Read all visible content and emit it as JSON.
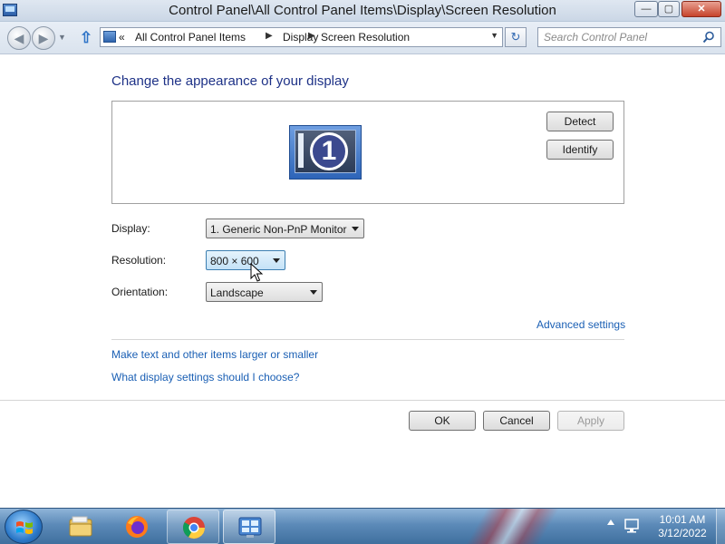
{
  "window": {
    "title": "Control Panel\\All Control Panel Items\\Display\\Screen Resolution",
    "min_label": "—",
    "max_label": "▢",
    "close_label": "✕"
  },
  "address": {
    "recent_glyph": "▼",
    "lead_chevron": "«",
    "segments": [
      "All Control Panel Items",
      "Display",
      "Screen Resolution"
    ],
    "separator": "▶",
    "dropdown_glyph": "▼",
    "refresh_glyph": "↻"
  },
  "search": {
    "placeholder": "Search Control Panel"
  },
  "page": {
    "heading": "Change the appearance of your display",
    "monitor_number": "1",
    "detect_label": "Detect",
    "identify_label": "Identify",
    "display_label": "Display:",
    "display_value": "1. Generic Non-PnP Monitor",
    "resolution_label": "Resolution:",
    "resolution_value": "800 × 600",
    "orientation_label": "Orientation:",
    "orientation_value": "Landscape",
    "advanced_link": "Advanced settings",
    "larger_link": "Make text and other items larger or smaller",
    "which_link": "What display settings should I choose?",
    "ok_label": "OK",
    "cancel_label": "Cancel",
    "apply_label": "Apply"
  },
  "taskbar": {
    "items": [
      "Windows Explorer",
      "Firefox",
      "Chrome",
      "Control Panel"
    ],
    "time": "10:01 AM",
    "date": "3/12/2022"
  },
  "colors": {
    "link": "#1a5fb4",
    "heading": "#1e3287",
    "accent": "#2d64b8"
  }
}
